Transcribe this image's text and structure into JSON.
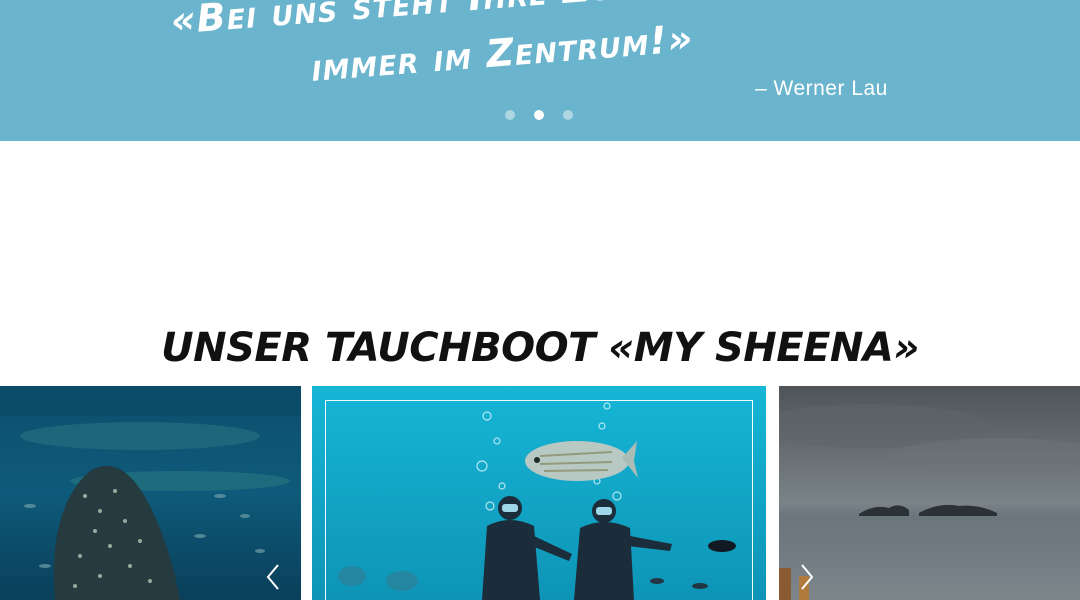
{
  "testimonial": {
    "quote": "«Bei uns steht Ihre Zufriedenheit immer im Zentrum!»",
    "author": "– Werner Lau",
    "slide_count": 3,
    "active_slide": 2
  },
  "section": {
    "title": "UNSER TAUCHBOOT «MY SHEENA»"
  },
  "gallery": {
    "images": [
      {
        "subject": "whale shark underwater"
      },
      {
        "subject": "two scuba divers with a fish"
      },
      {
        "subject": "sea view with island"
      }
    ],
    "prev_icon": "chevron-left-icon",
    "next_icon": "chevron-right-icon"
  },
  "colors": {
    "banner": "#6bb4cd",
    "title": "#111111"
  }
}
